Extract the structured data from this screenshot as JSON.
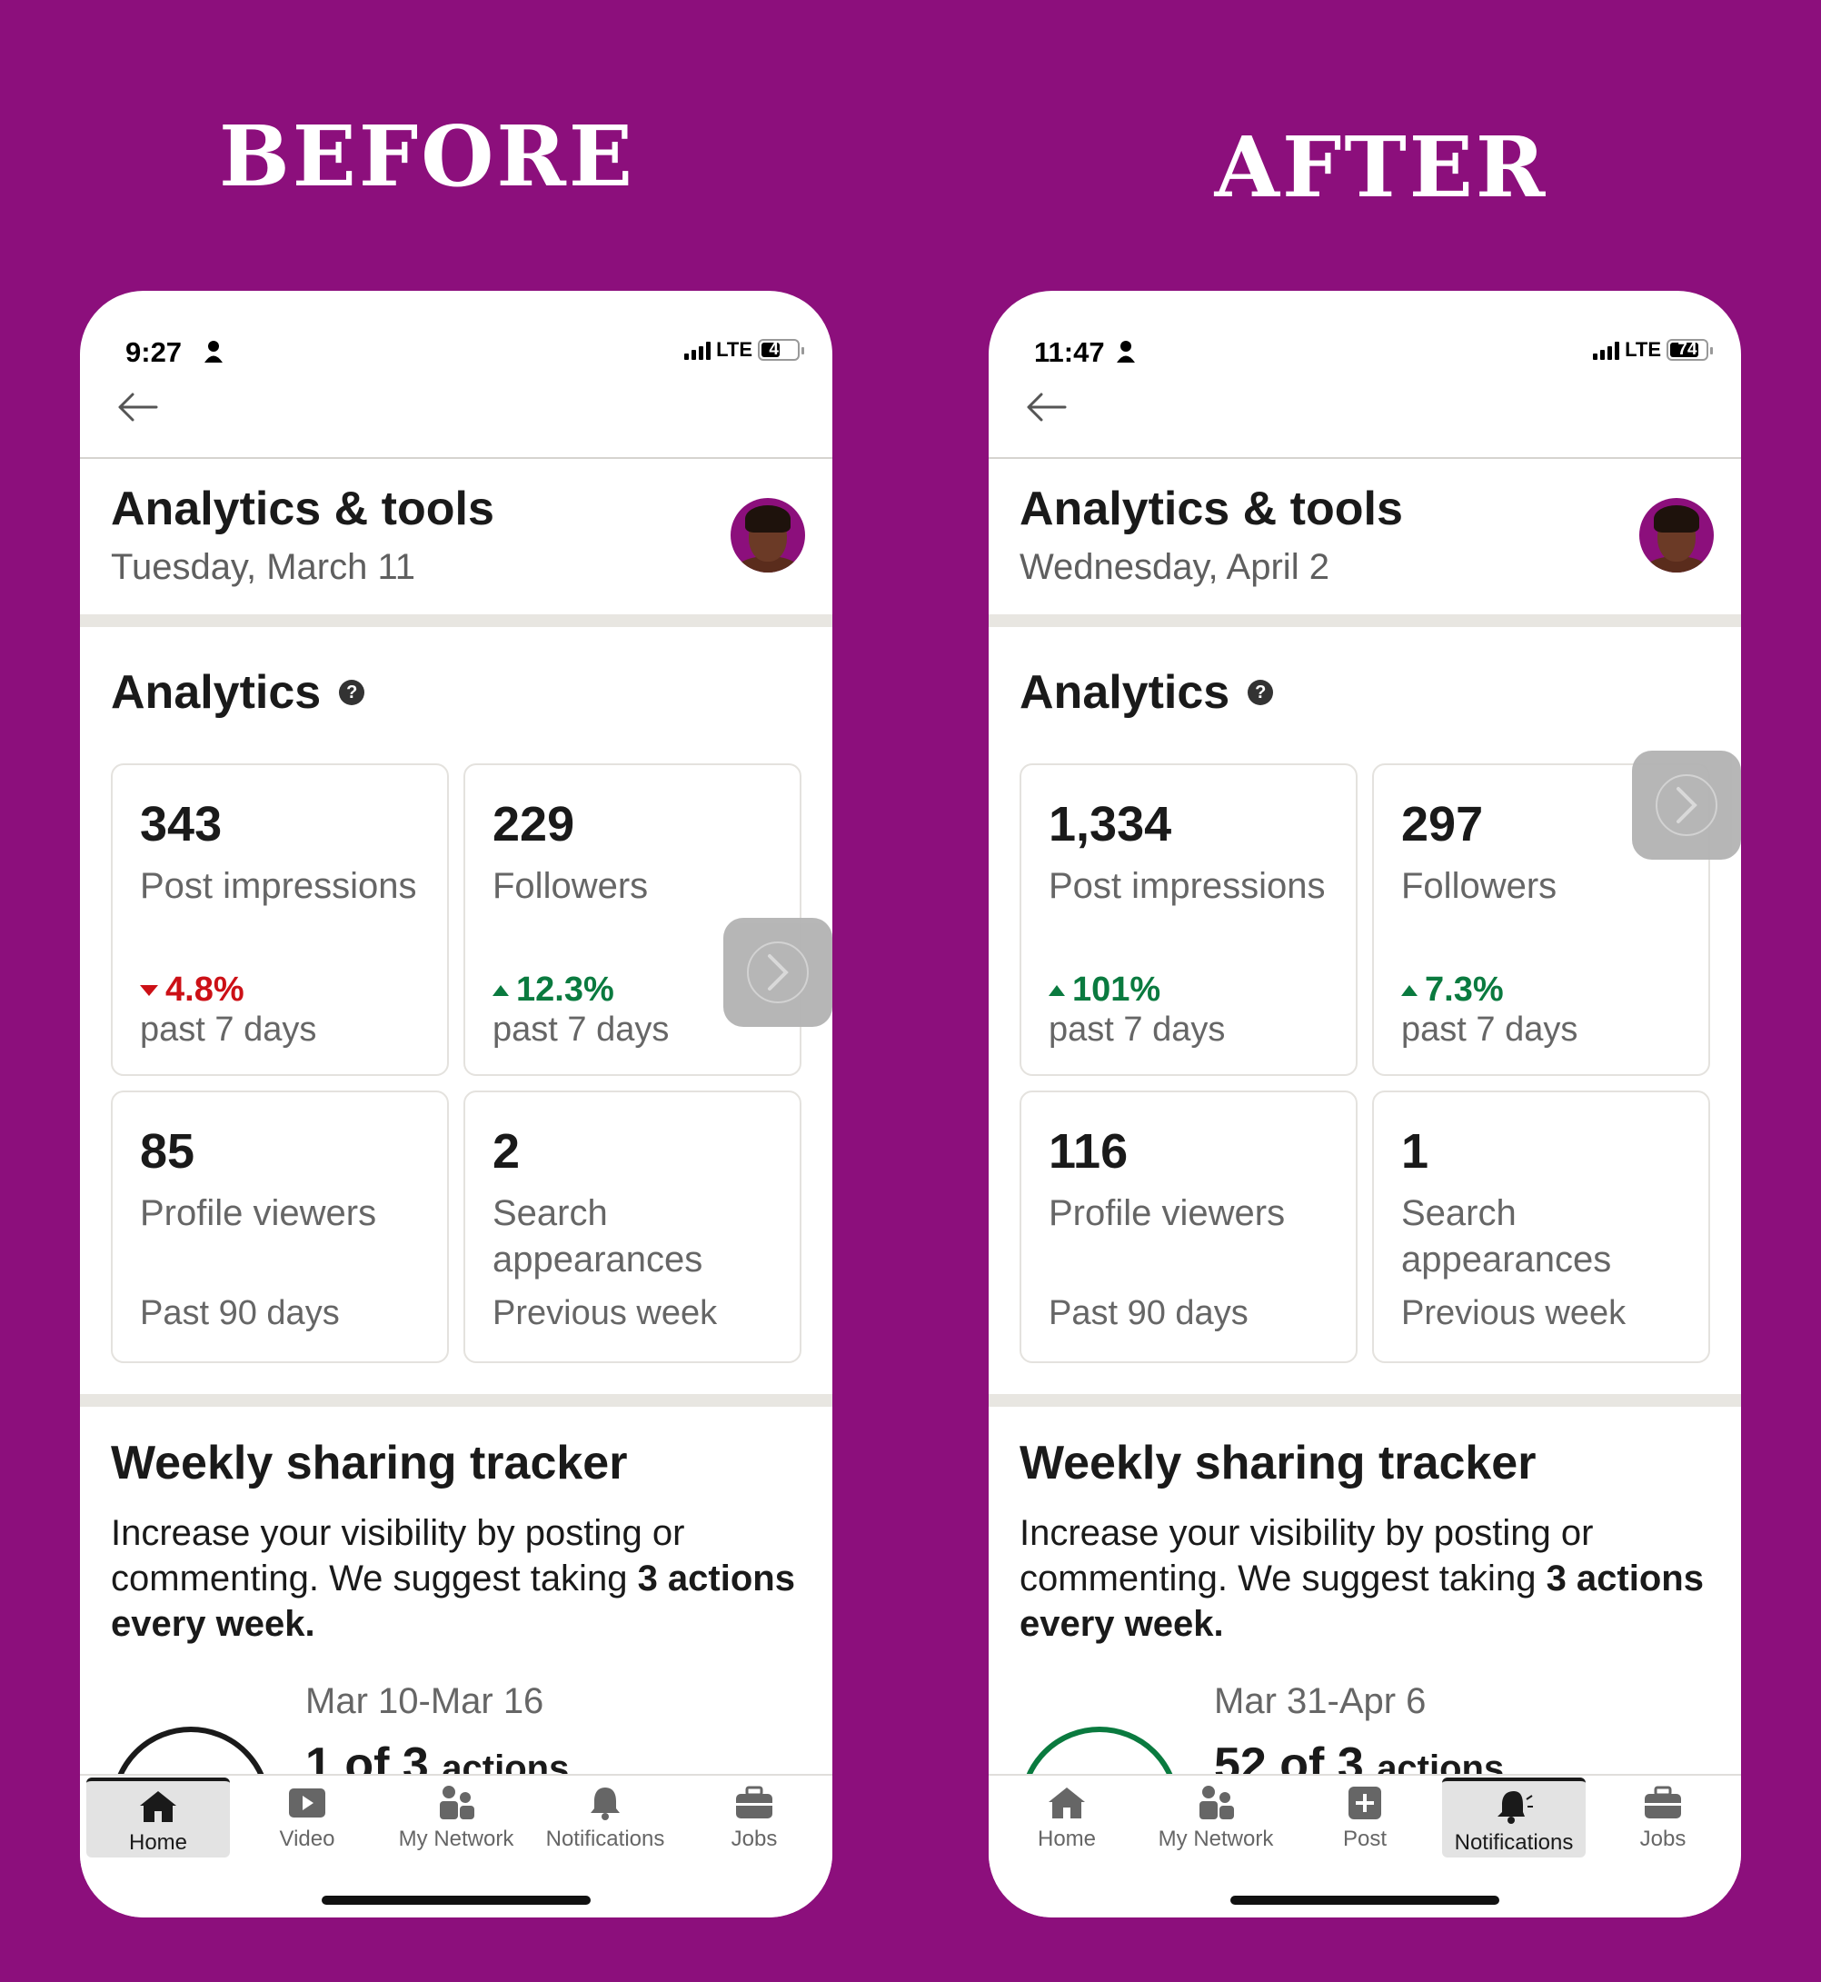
{
  "headings": {
    "before": "BEFORE",
    "after": "AFTER"
  },
  "icons": [
    "person-icon",
    "signal-icon",
    "battery-icon",
    "back-arrow-icon",
    "help-icon",
    "chevron-right-icon",
    "home-icon",
    "video-icon",
    "my-network-icon",
    "post-icon",
    "notifications-icon",
    "jobs-icon"
  ],
  "colors": {
    "background": "#8c0f7c",
    "increase": "#0a7a3f",
    "decrease": "#cc1016"
  },
  "before": {
    "status": {
      "time": "9:27",
      "network": "LTE",
      "battery": "47"
    },
    "title": "Analytics & tools",
    "date": "Tuesday, March 11",
    "analytics_title": "Analytics",
    "cards": [
      {
        "value": "343",
        "label": "Post impressions",
        "change": "4.8%",
        "direction": "down",
        "period": "past 7 days"
      },
      {
        "value": "229",
        "label": "Followers",
        "change": "12.3%",
        "direction": "up",
        "period": "past 7 days"
      },
      {
        "value": "85",
        "label": "Profile viewers",
        "period": "Past 90 days"
      },
      {
        "value": "2",
        "label": "Search appearances",
        "period": "Previous week"
      }
    ],
    "tracker": {
      "title": "Weekly sharing tracker",
      "text_a": "Increase your visibility by posting or commenting. We suggest taking ",
      "text_b": "3 actions every week.",
      "range": "Mar 10-Mar 16",
      "count": "1 of 3",
      "count_suffix": "actions"
    },
    "tabs": [
      "Home",
      "Video",
      "My Network",
      "Notifications",
      "Jobs"
    ],
    "active_tab": "Home"
  },
  "after": {
    "status": {
      "time": "11:47",
      "network": "LTE",
      "battery": "74"
    },
    "title": "Analytics & tools",
    "date": "Wednesday, April 2",
    "analytics_title": "Analytics",
    "cards": [
      {
        "value": "1,334",
        "label": "Post impressions",
        "change": "101%",
        "direction": "up",
        "period": "past 7 days"
      },
      {
        "value": "297",
        "label": "Followers",
        "change": "7.3%",
        "direction": "up",
        "period": "past 7 days"
      },
      {
        "value": "116",
        "label": "Profile viewers",
        "period": "Past 90 days"
      },
      {
        "value": "1",
        "label": "Search appearances",
        "period": "Previous week"
      }
    ],
    "tracker": {
      "title": "Weekly sharing tracker",
      "text_a": "Increase your visibility by posting or commenting. We suggest taking ",
      "text_b": "3 actions every week.",
      "range": "Mar 31-Apr 6",
      "count": "52 of 3",
      "count_suffix": "actions"
    },
    "tabs": [
      "Home",
      "My Network",
      "Post",
      "Notifications",
      "Jobs"
    ],
    "active_tab": "Notifications"
  }
}
